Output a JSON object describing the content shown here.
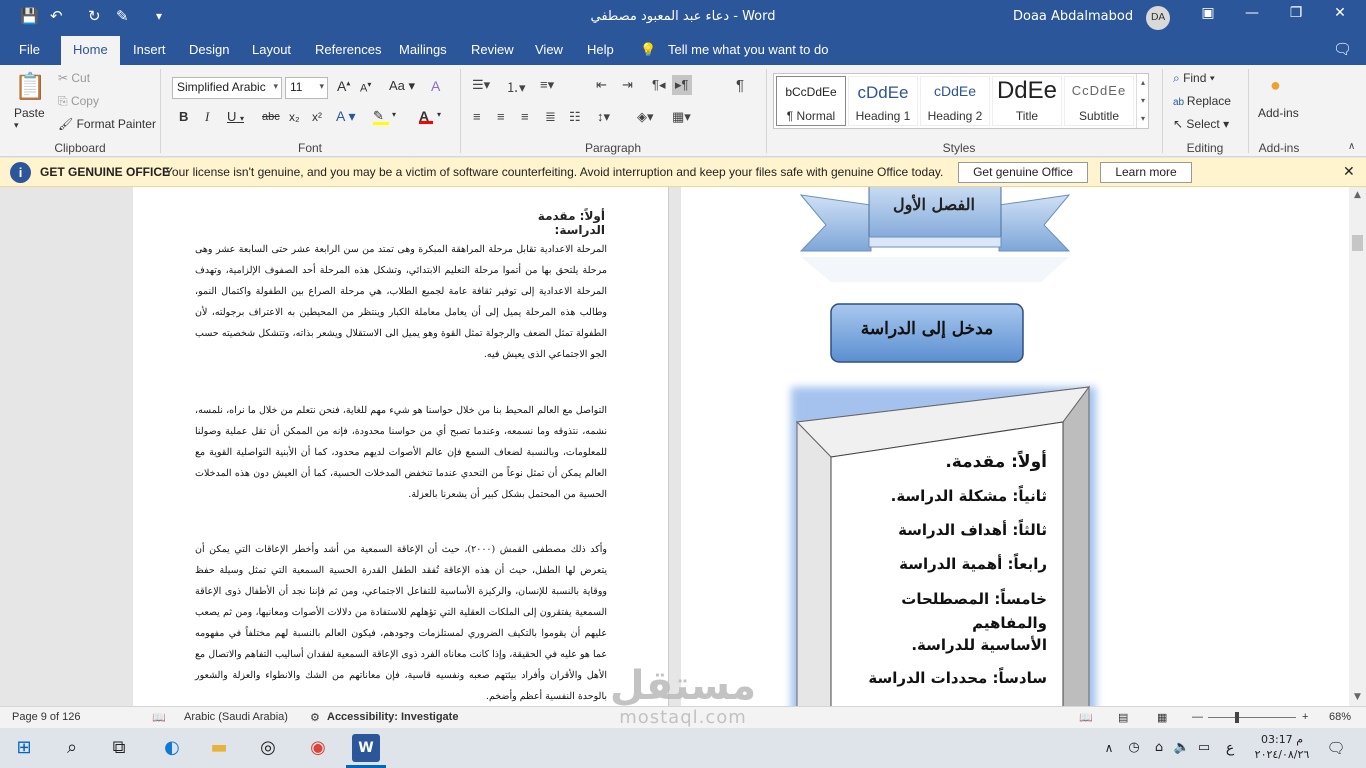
{
  "window": {
    "title": "دعاء عبد المعبود مصطفي  -  Word",
    "user_name": "Doaa Abdalmabod",
    "user_initials": "DA"
  },
  "tabs": [
    "File",
    "Home",
    "Insert",
    "Design",
    "Layout",
    "References",
    "Mailings",
    "Review",
    "View",
    "Help"
  ],
  "tell_me": "Tell me what you want to do",
  "clipboard": {
    "paste": "Paste",
    "cut": "Cut",
    "copy": "Copy",
    "format_painter": "Format Painter",
    "label": "Clipboard"
  },
  "font": {
    "name": "Simplified Arabic",
    "size": "11",
    "label": "Font",
    "bold": "B",
    "italic": "I",
    "underline": "U",
    "strike": "abc",
    "sub": "x₂",
    "sup": "x²",
    "grow": "A",
    "shrink": "A",
    "case": "Aa",
    "highlight_color": "#ffff00",
    "font_color": "#ff0000"
  },
  "paragraph": {
    "label": "Paragraph",
    "pilcrow": "¶"
  },
  "styles": {
    "label": "Styles",
    "items": [
      {
        "preview": "bCcDdEe",
        "name": "¶ Normal"
      },
      {
        "preview": "cDdEe",
        "name": "Heading 1"
      },
      {
        "preview": "cDdEe",
        "name": "Heading 2"
      },
      {
        "preview": "DdEe",
        "name": "Title"
      },
      {
        "preview": "CcDdEe",
        "name": "Subtitle"
      }
    ]
  },
  "editing": {
    "label": "Editing",
    "find": "Find",
    "replace": "Replace",
    "select": "Select"
  },
  "addins": {
    "label": "Add-ins",
    "button": "Add-ins"
  },
  "infobar": {
    "title": "GET GENUINE OFFICE",
    "message": "Your license isn't genuine, and you may be a victim of software counterfeiting. Avoid interruption and keep your files safe with genuine Office today.",
    "btn_get": "Get genuine Office",
    "btn_learn": "Learn more"
  },
  "document": {
    "heading": "أولاً: مقدمة الدراسة:",
    "paragraphs": [
      "المرحلة الاعدادية تقابل مرحلة المراهقة المبكرة وهى تمتد من سن الرابعة عشر حتى السابعة عشر وهى مرحلة يلتحق بها من أتموا مرحلة التعليم الابتدائي، وتشكل هذه المرحلة أحد الصفوف الإلزامية، وتهدف المرحلة الاعدادية إلى توفير ثقافة عامة لجميع الطلاب، هي مرحلة الصراع بين الطفولة واكتمال النمو، وطالب هذه المرحلة يميل إلى أن يعامل معاملة الكبار وينتظر من المحيطين به الاعتراف برجولته، لأن الطفولة تمثل الضعف والرجولة تمثل القوة وهو يميل الى الاستقلال ويشعر بذاته، وتتشكل شخصيته حسب الجو الاجتماعي الذى يعيش فيه.",
      "التواصل مع العالم المحيط بنا من خلال حواسنا هو شيء مهم للغاية، فنحن نتعلم من خلال ما نراه، نلمسه، نشمه، نتذوقه وما نسمعه، وعندما تصبح أي من حواسنا محدودة، فإنه من الممكن أن تقل عملية وصولنا للمعلومات، وبالنسبة لضعاف السمع فإن عالم الأصوات لديهم محدود، كما أن الأبنية التواصلية القوية مع العالم يمكن أن تمثل نوعاً من التحدي عندما تنخفض المدخلات الحسية، كما أن العيش دون هذه المدخلات الحسية من المحتمل بشكل كبير أن يشعرنا بالعزلة.",
      "وأكد ذلك مصطفى القمش (٢٠٠٠)، حيث أن الإعاقة السمعية من أشد وأخطر الإعاقات التي يمكن أن يتعرض لها الطفل، حيث أن هذه الإعاقة تُفقد الطفل القدرة الحسية السمعية التي تمثل وسيلة حفظ ووقاية بالنسبة للإنسان، والركيزة الأساسية للتفاعل الاجتماعي، ومن ثم فإننا نجد أن الأطفال ذوى الإعاقة السمعية يفتقرون إلى الملكات العقلية التي تؤهلهم للاستفادة من دلالات الأصوات ومعانيها، ومن ثم يصعب عليهم أن يقوموا بالتكيف الضروري لمستلزمات وجودهم، فيكون العالم بالنسبة لهم مختلفاً في مفهومه عما هو عليه في الحقيقة، وإذا كانت معاناه الفرد ذوى الإعاقة السمعية لفقدان أساليب التفاهم والاتصال مع الأهل والأقران وأفراد بيئتهم صعبه ونفسيه قاسية، فإن معاناتهم من الشك والانطواء والعزلة والشعور بالوحدة النفسية أعظم وأضخم."
    ],
    "banner_title": "الفصل الأول",
    "chapter_box": "مدخل إلى الدراسة",
    "toc": [
      "أولاً: مقدمة.",
      "ثانياً: مشكلة الدراسة.",
      "ثالثاً: أهداف الدراسة",
      "رابعاً: أهمية الدراسة",
      "خامساً: المصطلحات والمفاهيم",
      "الأساسية للدراسة.",
      "سادساً: محددات الدراسة"
    ]
  },
  "status": {
    "page": "Page 9 of 126",
    "language": "Arabic (Saudi Arabia)",
    "accessibility": "Accessibility: Investigate",
    "zoom": "68%"
  },
  "watermark": {
    "ar": "مستقل",
    "en": "mostaql.com"
  },
  "taskbar": {
    "time": "03:17 م",
    "date": "٢٠٢٤/٠٨/٢٦",
    "lang": "ع"
  }
}
